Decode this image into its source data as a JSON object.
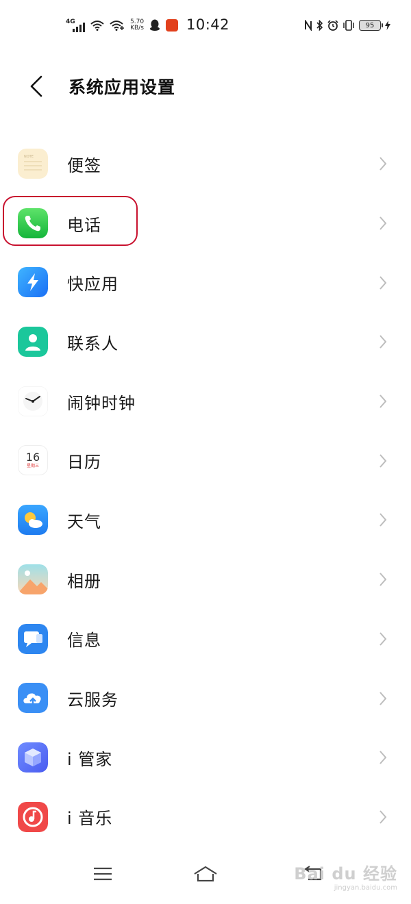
{
  "status_bar": {
    "network": "4G",
    "speed_value": "5.70",
    "speed_unit": "KB/s",
    "time": "10:42",
    "battery": "95"
  },
  "header": {
    "title": "系统应用设置",
    "back_icon": "chevron-left-icon"
  },
  "apps": [
    {
      "label": "便签",
      "icon": "notes-icon"
    },
    {
      "label": "电话",
      "icon": "phone-icon"
    },
    {
      "label": "快应用",
      "icon": "quick-app-icon"
    },
    {
      "label": "联系人",
      "icon": "contacts-icon"
    },
    {
      "label": "闹钟时钟",
      "icon": "clock-icon"
    },
    {
      "label": "日历",
      "icon": "calendar-icon",
      "icon_text": "16",
      "icon_subtext": "星期三"
    },
    {
      "label": "天气",
      "icon": "weather-icon"
    },
    {
      "label": "相册",
      "icon": "album-icon"
    },
    {
      "label": "信息",
      "icon": "messages-icon"
    },
    {
      "label": "云服务",
      "icon": "cloud-service-icon"
    },
    {
      "label": "i 管家",
      "icon": "i-manager-icon"
    },
    {
      "label": "i 音乐",
      "icon": "i-music-icon"
    }
  ],
  "highlighted_item": "电话",
  "nav_bar": {
    "menu_icon": "menu-icon",
    "home_icon": "home-icon",
    "back_icon": "back-icon"
  },
  "watermark": {
    "text": "Bai du 经验",
    "url": "jingyan.baidu.com"
  },
  "colors": {
    "highlight": "#c8102e",
    "chevron": "#bdbdbd",
    "phone_green": "#22c548",
    "quick_app_blue": "#1f8cff",
    "contacts_teal": "#1bc79b",
    "music_red": "#f04848"
  }
}
